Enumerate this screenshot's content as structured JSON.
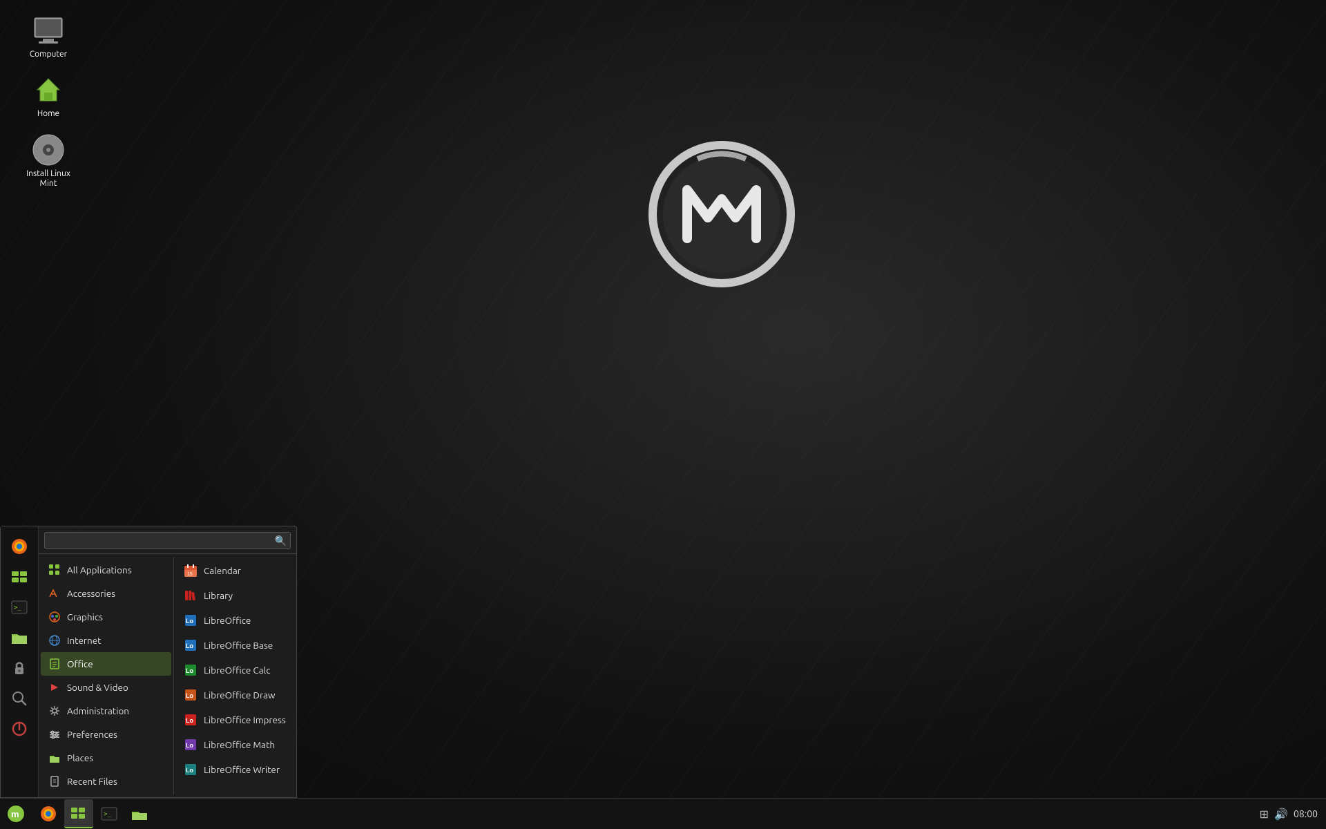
{
  "desktop": {
    "icons": [
      {
        "id": "computer",
        "label": "Computer",
        "icon": "🖥"
      },
      {
        "id": "home",
        "label": "Home",
        "icon": "🏠"
      },
      {
        "id": "install",
        "label": "Install Linux Mint",
        "icon": "💿"
      }
    ]
  },
  "taskbar": {
    "start_icon": "🌿",
    "apps": [
      {
        "id": "firefox",
        "icon": "🦊",
        "active": false
      },
      {
        "id": "mint-menu",
        "icon": "🔲",
        "active": true
      },
      {
        "id": "terminal",
        "icon": "⬛",
        "active": false
      },
      {
        "id": "files",
        "icon": "📁",
        "active": false
      }
    ],
    "time": "08:00"
  },
  "start_menu": {
    "search": {
      "placeholder": "",
      "value": ""
    },
    "sidebar_buttons": [
      {
        "id": "firefox",
        "icon": "🦊"
      },
      {
        "id": "mint-menu",
        "icon": "🔲"
      },
      {
        "id": "terminal-small",
        "icon": "💻"
      },
      {
        "id": "files-small",
        "icon": "📁"
      },
      {
        "id": "lock",
        "icon": "🔒"
      },
      {
        "id": "search-app",
        "icon": "🔍"
      },
      {
        "id": "power",
        "icon": "⏻"
      }
    ],
    "categories": [
      {
        "id": "all",
        "label": "All Applications",
        "icon": "⊞",
        "active": false
      },
      {
        "id": "accessories",
        "label": "Accessories",
        "icon": "✂",
        "active": false
      },
      {
        "id": "graphics",
        "label": "Graphics",
        "icon": "🎨",
        "active": false
      },
      {
        "id": "internet",
        "label": "Internet",
        "icon": "🌐",
        "active": false
      },
      {
        "id": "office",
        "label": "Office",
        "icon": "📄",
        "active": true
      },
      {
        "id": "sound-video",
        "label": "Sound & Video",
        "icon": "▶",
        "active": false
      },
      {
        "id": "administration",
        "label": "Administration",
        "icon": "⚙",
        "active": false
      },
      {
        "id": "preferences",
        "label": "Preferences",
        "icon": "🔧",
        "active": false
      },
      {
        "id": "places",
        "label": "Places",
        "icon": "📁",
        "active": false
      },
      {
        "id": "recent",
        "label": "Recent Files",
        "icon": "📄",
        "active": false
      }
    ],
    "apps": [
      {
        "id": "calendar",
        "label": "Calendar",
        "icon": "📅",
        "color": "#e8734a"
      },
      {
        "id": "library",
        "label": "Library",
        "icon": "📚",
        "color": "#c9211e"
      },
      {
        "id": "libreoffice",
        "label": "LibreOffice",
        "icon": "Lo",
        "color": "#1f6fba"
      },
      {
        "id": "libreoffice-base",
        "label": "LibreOffice Base",
        "icon": "Lo",
        "color": "#1f6fba"
      },
      {
        "id": "libreoffice-calc",
        "label": "LibreOffice Calc",
        "icon": "Lo",
        "color": "#1e8a2e"
      },
      {
        "id": "libreoffice-draw",
        "label": "LibreOffice Draw",
        "icon": "Lo",
        "color": "#c7551a"
      },
      {
        "id": "libreoffice-impress",
        "label": "LibreOffice Impress",
        "icon": "Lo",
        "color": "#c9211e"
      },
      {
        "id": "libreoffice-math",
        "label": "LibreOffice Math",
        "icon": "Lo",
        "color": "#7239aa"
      },
      {
        "id": "libreoffice-writer",
        "label": "LibreOffice Writer",
        "icon": "Lo",
        "color": "#1d8080"
      }
    ]
  }
}
